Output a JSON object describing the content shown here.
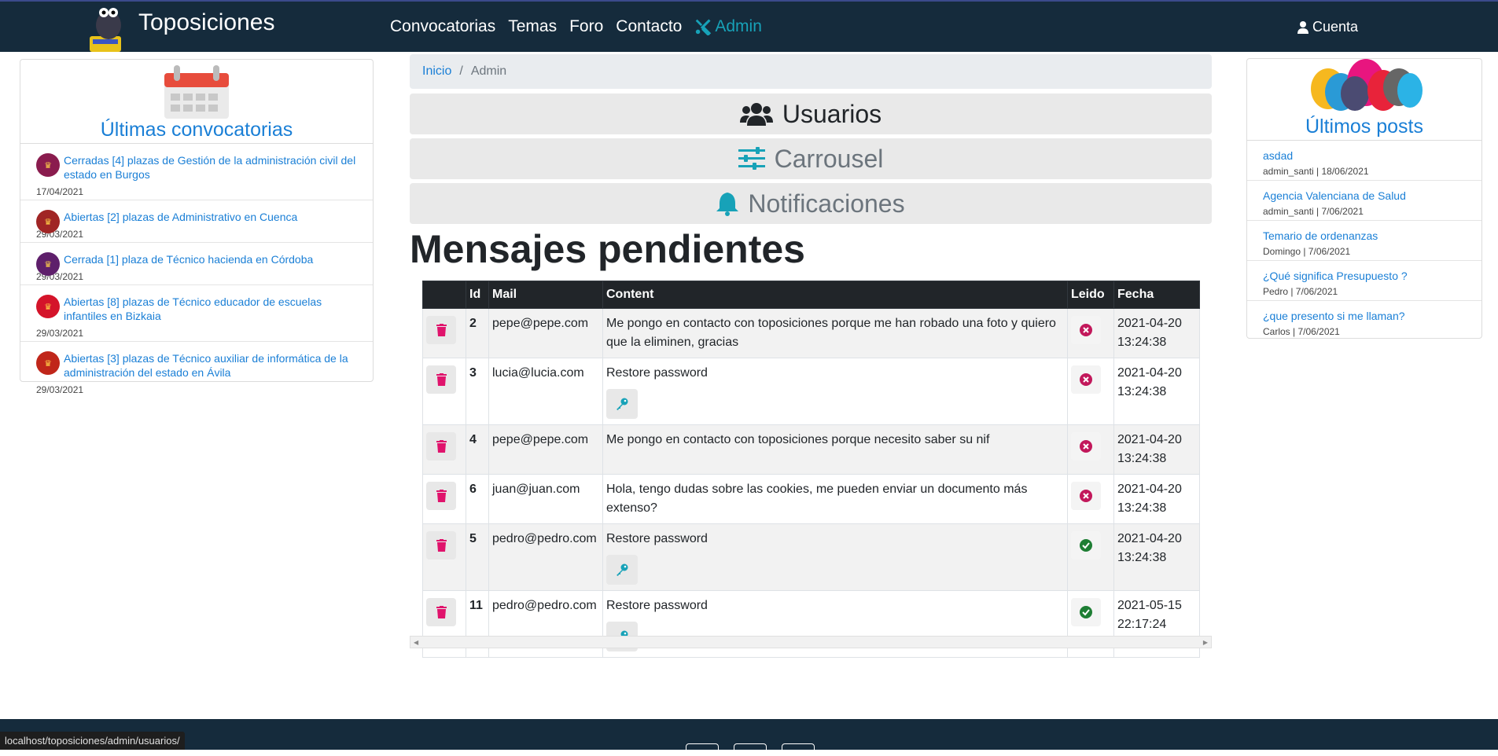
{
  "nav": {
    "brand": "Toposiciones",
    "links": [
      "Convocatorias",
      "Temas",
      "Foro",
      "Contacto"
    ],
    "admin": "Admin",
    "account": "Cuenta"
  },
  "left": {
    "title": "Últimas convocatorias",
    "items": [
      {
        "text": "Cerradas [4] plazas de Gestión de la administración civil del estado en Burgos",
        "date": "17/04/2021",
        "color": "#8a1c4e"
      },
      {
        "text": "Abiertas [2] plazas de Administrativo en Cuenca",
        "date": "29/03/2021",
        "color": "#a02525"
      },
      {
        "text": "Cerrada [1] plaza de Técnico hacienda en Córdoba",
        "date": "29/03/2021",
        "color": "#5e1f6b"
      },
      {
        "text": "Abiertas [8] plazas de Técnico educador de escuelas infantiles en Bizkaia",
        "date": "29/03/2021",
        "color": "#d4142a"
      },
      {
        "text": "Abiertas [3] plazas de Técnico auxiliar de informática de la administración del estado en Ávila",
        "date": "29/03/2021",
        "color": "#c0261a"
      }
    ]
  },
  "right": {
    "title": "Últimos posts",
    "posts": [
      {
        "title": "asdad",
        "meta": "admin_santi | 18/06/2021"
      },
      {
        "title": "Agencia Valenciana de Salud",
        "meta": "admin_santi | 7/06/2021"
      },
      {
        "title": "Temario de ordenanzas",
        "meta": "Domingo | 7/06/2021"
      },
      {
        "title": "¿Qué significa Presupuesto ?",
        "meta": "Pedro | 7/06/2021"
      },
      {
        "title": "¿que presento si me llaman?",
        "meta": "Carlos | 7/06/2021"
      }
    ]
  },
  "breadcrumb": {
    "home": "Inicio",
    "sep": "/",
    "current": "Admin"
  },
  "admin_sections": {
    "users": "Usuarios",
    "carousel": "Carrousel",
    "notifications": "Notificaciones"
  },
  "messages": {
    "title": "Mensajes pendientes",
    "headers": [
      "",
      "Id",
      "Mail",
      "Content",
      "Leido",
      "Fecha"
    ],
    "rows": [
      {
        "id": "2",
        "mail": "pepe@pepe.com",
        "content": "Me pongo en contacto con toposiciones porque me han robado una foto y quiero que la eliminen, gracias",
        "read": false,
        "date": "2021-04-20 13:24:38",
        "key": false
      },
      {
        "id": "3",
        "mail": "lucia@lucia.com",
        "content": "Restore password",
        "read": false,
        "date": "2021-04-20 13:24:38",
        "key": true
      },
      {
        "id": "4",
        "mail": "pepe@pepe.com",
        "content": "Me pongo en contacto con toposiciones porque necesito saber su nif",
        "read": false,
        "date": "2021-04-20 13:24:38",
        "key": false
      },
      {
        "id": "6",
        "mail": "juan@juan.com",
        "content": "Hola, tengo dudas sobre las cookies, me pueden enviar un documento más extenso?",
        "read": false,
        "date": "2021-04-20 13:24:38",
        "key": false
      },
      {
        "id": "5",
        "mail": "pedro@pedro.com",
        "content": "Restore password",
        "read": true,
        "date": "2021-04-20 13:24:38",
        "key": true
      },
      {
        "id": "11",
        "mail": "pedro@pedro.com",
        "content": "Restore password",
        "read": true,
        "date": "2021-05-15 22:17:24",
        "key": true
      }
    ]
  },
  "status_bar": "localhost/toposiciones/admin/usuarios/",
  "colors": {
    "navbar": "#152b3c",
    "link": "#1a7fd6",
    "accent": "#17a2b8",
    "delete": "#e0136c",
    "unread": "#c2185b",
    "read": "#1e7e34"
  }
}
